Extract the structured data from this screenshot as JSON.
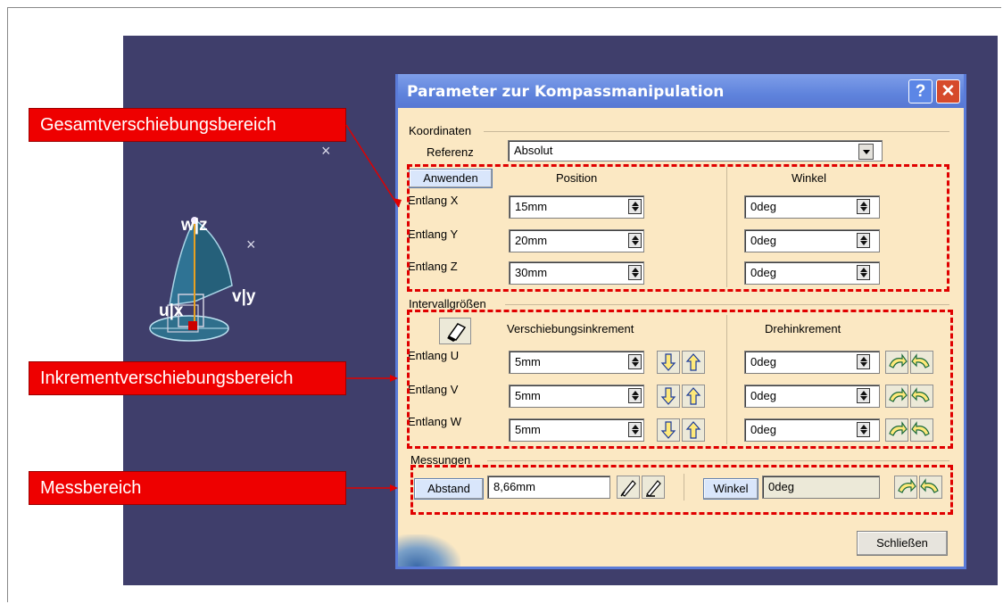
{
  "dialog": {
    "title": "Parameter zur Kompassmanipulation",
    "help_label": "?",
    "close_label": "✕",
    "coordinates_group": "Koordinaten",
    "reference_label": "Referenz",
    "reference_value": "Absolut",
    "apply_label": "Anwenden",
    "position_header": "Position",
    "angle_header": "Winkel",
    "rows_position": [
      {
        "label": "Entlang X",
        "position": "15mm",
        "angle": "0deg"
      },
      {
        "label": "Entlang Y",
        "position": "20mm",
        "angle": "0deg"
      },
      {
        "label": "Entlang Z",
        "position": "30mm",
        "angle": "0deg"
      }
    ],
    "interval_group": "Intervallgrößen",
    "translation_increment_header": "Verschiebungsinkrement",
    "rotation_increment_header": "Drehinkrement",
    "rows_increment": [
      {
        "label": "Entlang U",
        "translation": "5mm",
        "rotation": "0deg"
      },
      {
        "label": "Entlang V",
        "translation": "5mm",
        "rotation": "0deg"
      },
      {
        "label": "Entlang W",
        "translation": "5mm",
        "rotation": "0deg"
      }
    ],
    "measurements_group": "Messungen",
    "distance_label": "Abstand",
    "distance_value": "8,66mm",
    "angle_button_label": "Winkel",
    "angle_value": "0deg",
    "close_button_label": "Schließen"
  },
  "compass": {
    "axis_w_z": "w|z",
    "axis_v_y": "v|y",
    "axis_u_x": "u|x"
  },
  "viewport_marks": [
    "×",
    "×"
  ],
  "callouts": {
    "total_translation": "Gesamtverschiebungsbereich",
    "increment_translation": "Inkrementverschiebungsbereich",
    "measurement": "Messbereich"
  },
  "colors": {
    "viewport": "#3f3e6b",
    "dialog_bg": "#fbe8c3",
    "titlebar": "#5f83dc",
    "callout": "#ee0000",
    "dash": "#e00000"
  },
  "icons": {
    "eraser": "eraser-icon",
    "translate_down": "arrow-down-icon",
    "translate_up": "arrow-up-icon",
    "rotate_ccw": "rotate-left-icon",
    "rotate_cw": "rotate-right-icon",
    "measure_distance": "distance-measure-icon",
    "measure_angle": "angle-measure-icon"
  }
}
